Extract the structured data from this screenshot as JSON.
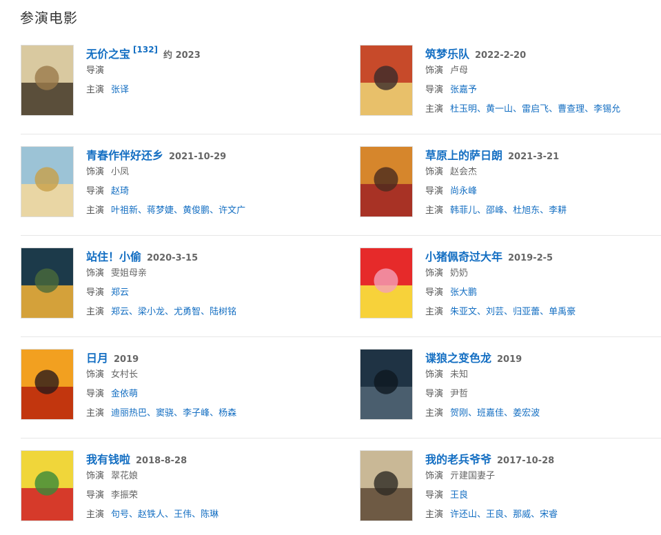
{
  "section_title": "参演电影",
  "labels": {
    "role": "饰演",
    "director": "导演",
    "star": "主演"
  },
  "films": [
    {
      "title": "无价之宝",
      "ref": "[132]",
      "year": "约 2023",
      "role": null,
      "role_label": null,
      "director": "",
      "director_is_link": false,
      "stars": [
        "张译"
      ],
      "poster_colors": [
        "#d9c9a0",
        "#5a4e3a",
        "#9a7b4b"
      ]
    },
    {
      "title": "筑梦乐队",
      "ref": null,
      "year": "2022-2-20",
      "role": "卢母",
      "director": "张嘉予",
      "director_is_link": true,
      "stars": [
        "杜玉明",
        "黄一山",
        "雷启飞",
        "曹查理",
        "李锡允"
      ],
      "poster_colors": [
        "#c74a2a",
        "#e8c06a",
        "#3a2a2a"
      ]
    },
    {
      "title": "青春作伴好还乡",
      "ref": null,
      "year": "2021-10-29",
      "role": "小凤",
      "director": "赵琦",
      "director_is_link": true,
      "stars": [
        "叶祖新",
        "蒋梦婕",
        "黄俊鹏",
        "许文广"
      ],
      "poster_colors": [
        "#9cc3d6",
        "#e9d6a4",
        "#c8a048"
      ]
    },
    {
      "title": "草原上的萨日朗",
      "ref": null,
      "year": "2021-3-21",
      "role": "赵会杰",
      "director": "尚永峰",
      "director_is_link": true,
      "stars": [
        "韩菲儿",
        "邵峰",
        "杜旭东",
        "李耕"
      ],
      "poster_colors": [
        "#d6862c",
        "#a83225",
        "#4a2a1e"
      ]
    },
    {
      "title": "站住！小偷",
      "ref": null,
      "year": "2020-3-15",
      "role": "雯姐母亲",
      "director": "郑云",
      "director_is_link": true,
      "stars": [
        "郑云",
        "梁小龙",
        "尤勇智",
        "陆树铭"
      ],
      "poster_colors": [
        "#1c3a4a",
        "#d4a13a",
        "#4a6a3a"
      ]
    },
    {
      "title": "小猪佩奇过大年",
      "ref": null,
      "year": "2019-2-5",
      "role": "奶奶",
      "director": "张大鹏",
      "director_is_link": true,
      "stars": [
        "朱亚文",
        "刘芸",
        "归亚蕾",
        "单禹豪"
      ],
      "poster_colors": [
        "#e62a2a",
        "#f7d23a",
        "#f4a0b8"
      ]
    },
    {
      "title": "日月",
      "ref": null,
      "year": "2019",
      "role": "女村长",
      "director": "金依萌",
      "director_is_link": true,
      "stars": [
        "迪丽热巴",
        "窦骁",
        "李子峰",
        "杨森"
      ],
      "poster_colors": [
        "#f2a020",
        "#c2360e",
        "#2a1a1a"
      ]
    },
    {
      "title": "谍狼之变色龙",
      "ref": null,
      "year": "2019",
      "role": "未知",
      "director": "尹哲",
      "director_is_link": false,
      "stars": [
        "贺刚",
        "班嘉佳",
        "姜宏波"
      ],
      "poster_colors": [
        "#1f3344",
        "#4a5e6e",
        "#0e1820"
      ]
    },
    {
      "title": "我有钱啦",
      "ref": null,
      "year": "2018-8-28",
      "role": "翠花娘",
      "director": "李振荣",
      "director_is_link": false,
      "stars": [
        "句号",
        "赵铁人",
        "王伟",
        "陈琳"
      ],
      "poster_colors": [
        "#f0d63a",
        "#d63a2a",
        "#3a8a3a"
      ]
    },
    {
      "title": "我的老兵爷爷",
      "ref": null,
      "year": "2017-10-28",
      "role": "亓建国妻子",
      "director": "王良",
      "director_is_link": true,
      "stars": [
        "许还山",
        "王良",
        "那威",
        "宋睿"
      ],
      "poster_colors": [
        "#c9b896",
        "#6e5a44",
        "#2e2a24"
      ]
    }
  ]
}
